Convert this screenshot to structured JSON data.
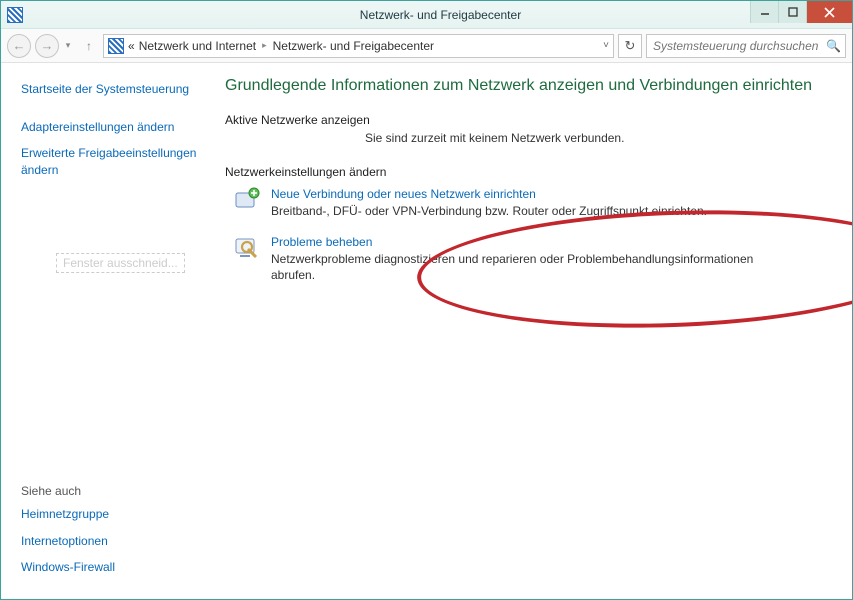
{
  "window": {
    "title": "Netzwerk- und Freigabecenter"
  },
  "nav": {
    "crumb1": "Netzwerk und Internet",
    "crumb2": "Netzwerk- und Freigabecenter",
    "chevrons": "«"
  },
  "search": {
    "placeholder": "Systemsteuerung durchsuchen"
  },
  "sidebar": {
    "home": "Startseite der Systemsteuerung",
    "adapter": "Adaptereinstellungen ändern",
    "sharing": "Erweiterte Freigabeeinstellungen ändern",
    "seeAlsoHead": "Siehe auch",
    "seeAlso1": "Heimnetzgruppe",
    "seeAlso2": "Internetoptionen",
    "seeAlso3": "Windows-Firewall"
  },
  "content": {
    "heading": "Grundlegende Informationen zum Netzwerk anzeigen und Verbindungen einrichten",
    "activeLabel": "Aktive Netzwerke anzeigen",
    "status": "Sie sind zurzeit mit keinem Netzwerk verbunden.",
    "changeLabel": "Netzwerkeinstellungen ändern",
    "task1": {
      "title": "Neue Verbindung oder neues Netzwerk einrichten",
      "desc": "Breitband-, DFÜ- oder VPN-Verbindung bzw. Router oder Zugriffspunkt einrichten."
    },
    "task2": {
      "title": "Probleme beheben",
      "desc": "Netzwerkprobleme diagnostizieren und reparieren oder Problembehandlungsinformationen abrufen."
    },
    "hiddenResult": "Fenster ausschneid..."
  }
}
